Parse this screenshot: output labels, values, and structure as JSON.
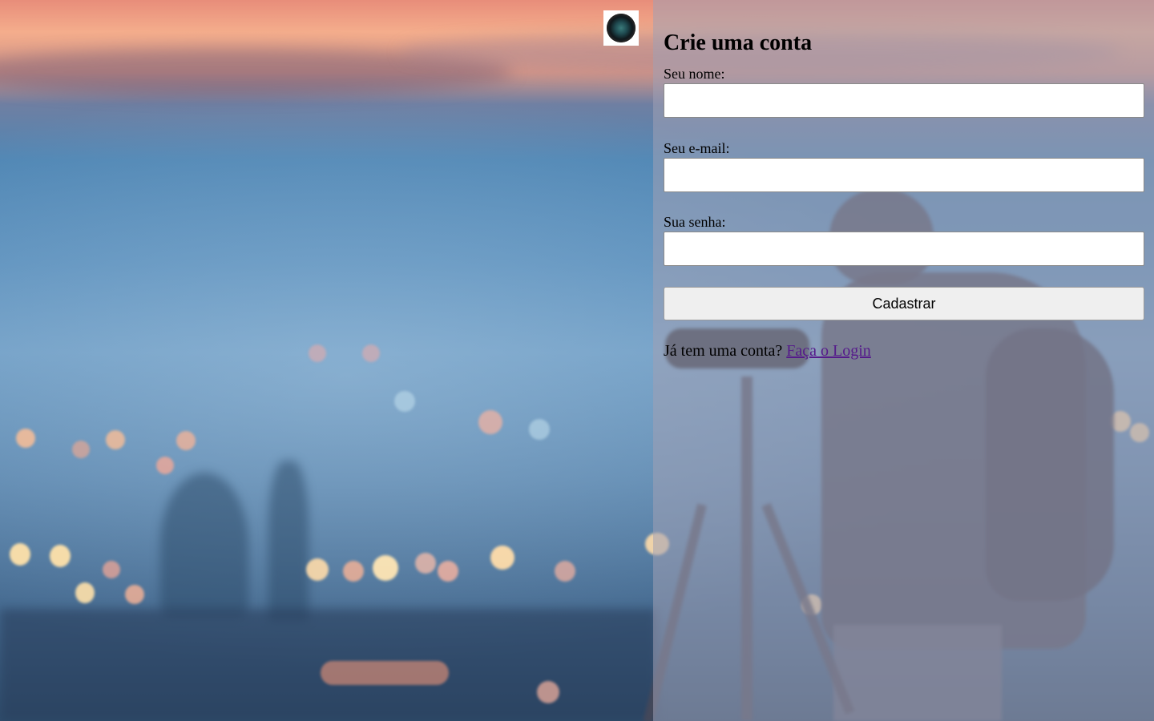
{
  "logo": {
    "icon": "camera-lens-icon"
  },
  "signup": {
    "title": "Crie uma conta",
    "name_label": "Seu nome:",
    "name_value": "",
    "email_label": "Seu e-mail:",
    "email_value": "",
    "password_label": "Sua senha:",
    "password_value": "",
    "submit_label": "Cadastrar",
    "login_prompt": "Já tem uma conta?",
    "login_link": "Faça o Login"
  },
  "colors": {
    "link_visited": "#551a8b",
    "button_bg": "#efefef",
    "panel_overlay": "rgba(160,160,180,0.55)"
  }
}
